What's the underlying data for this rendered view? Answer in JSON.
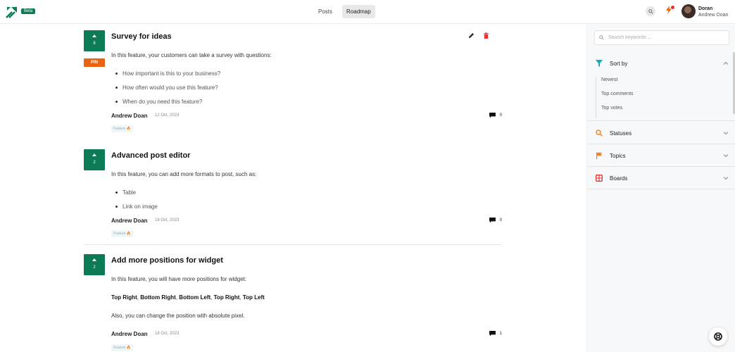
{
  "header": {
    "beta_label": "Beta",
    "nav": [
      {
        "label": "Posts"
      },
      {
        "label": "Roadmap"
      }
    ],
    "user": {
      "name": "Doran",
      "sub": "Andrew Doan"
    }
  },
  "posts": [
    {
      "votes": "8",
      "pin_label": "PIN",
      "title": "Survey for ideas",
      "intro": "In this feature, your customers can take a survey with questions:",
      "bullets": [
        "How important is this to your business?",
        "How often would you use this feature?",
        "When do you need this feature?"
      ],
      "author": "Andrew Doan",
      "date": "12 Oct, 2023",
      "comments": "0",
      "tag": "Feature 🔥"
    },
    {
      "votes": "2",
      "title": "Advanced post editor",
      "intro": "In this feature, you can add more formats to post, such as:",
      "bullets": [
        "Table",
        "Link on image"
      ],
      "author": "Andrew Doan",
      "date": "18 Oct, 2023",
      "comments": "0",
      "tag": "Feature 🔥"
    },
    {
      "votes": "2",
      "title": "Add more positions for widget",
      "intro": "In this feature, you will have more positions for widget:",
      "positions": [
        "Top Right",
        "Bottom Right",
        "Bottom Left",
        "Top Right",
        "Top Left"
      ],
      "outro": "Also, you can change the position with absolute pixel.",
      "author": "Andrew Doan",
      "date": "18 Oct, 2023",
      "comments": "1",
      "tag": "Feature 🔥"
    }
  ],
  "sidebar": {
    "search_placeholder": "Search keywords ...",
    "sort": {
      "label": "Sort by",
      "options": [
        "Newest",
        "Top comments",
        "Top votes"
      ]
    },
    "sections": [
      {
        "label": "Statuses"
      },
      {
        "label": "Topics"
      },
      {
        "label": "Boards"
      }
    ]
  },
  "colors": {
    "brand": "#0b7a55",
    "pin": "#e86412",
    "delete": "#e5322d",
    "filter": "#12a9c0",
    "topics": "#f0821e",
    "boards": "#e5322d"
  }
}
